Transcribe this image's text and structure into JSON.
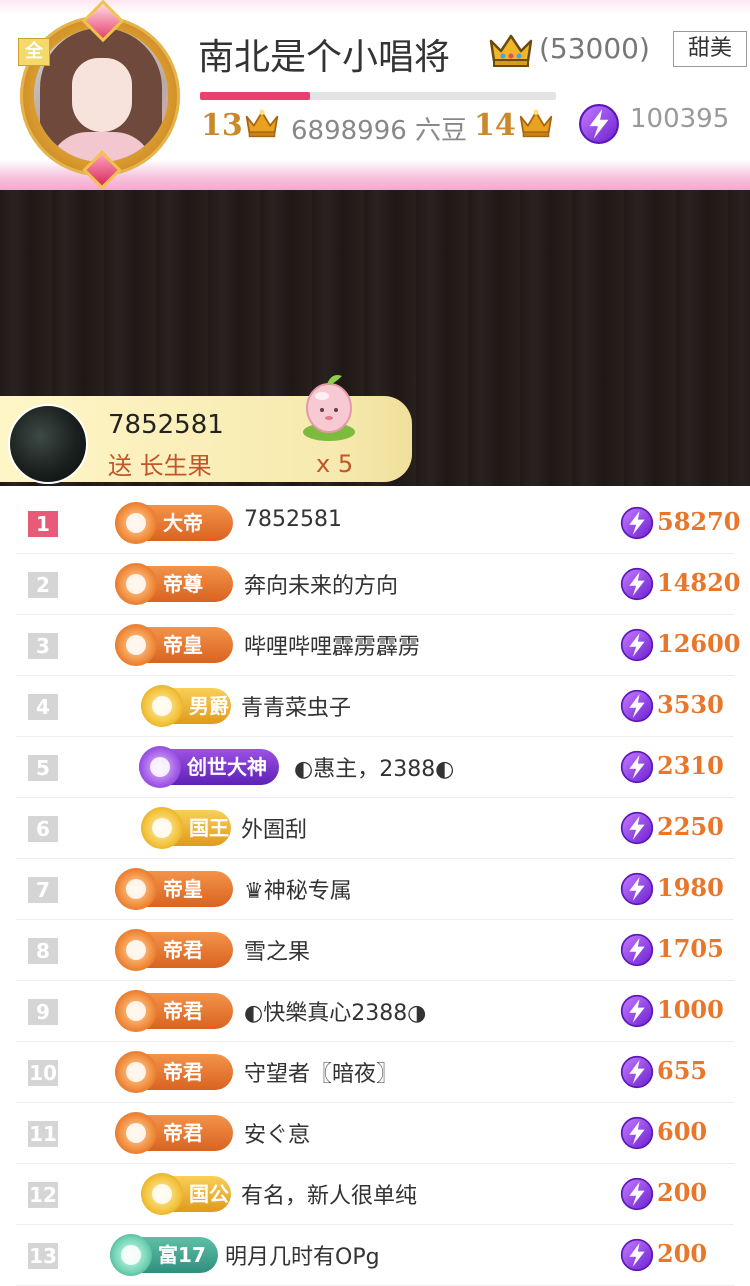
{
  "header": {
    "avatar_tag": "全",
    "streamer_name": "南北是个小唱将",
    "follower_count": "(53000)",
    "style_badge": "甜美",
    "level_progress": 0.31,
    "current_level": "13",
    "beans": "6898996 六豆",
    "next_level": "14",
    "points": "100395"
  },
  "gift_banner": {
    "sender_id": "7852581",
    "gift_text": "送 长生果",
    "count": "x 5"
  },
  "ranking": [
    {
      "rank": "1",
      "badge": "大帝",
      "badge_style": "orange",
      "name": "7852581",
      "points": "58270"
    },
    {
      "rank": "2",
      "badge": "帝尊",
      "badge_style": "orange",
      "name": "奔向未来的方向",
      "points": "14820"
    },
    {
      "rank": "3",
      "badge": "帝皇",
      "badge_style": "orange",
      "name": "哔哩哔哩霹雳霹雳",
      "points": "12600"
    },
    {
      "rank": "4",
      "badge": "男爵",
      "badge_style": "gold",
      "name": "青青菜虫子",
      "points": "3530"
    },
    {
      "rank": "5",
      "badge": "创世大神",
      "badge_style": "purple",
      "name": "◐惠主，2388◐",
      "points": "2310"
    },
    {
      "rank": "6",
      "badge": "国王",
      "badge_style": "gold",
      "name": "外圄刮",
      "points": "2250"
    },
    {
      "rank": "7",
      "badge": "帝皇",
      "badge_style": "orange",
      "name": "♛神秘专属",
      "points": "1980"
    },
    {
      "rank": "8",
      "badge": "帝君",
      "badge_style": "orange",
      "name": "雪之果",
      "points": "1705"
    },
    {
      "rank": "9",
      "badge": "帝君",
      "badge_style": "orange",
      "name": "◐快樂真心2388◑",
      "points": "1000"
    },
    {
      "rank": "10",
      "badge": "帝君",
      "badge_style": "orange",
      "name": "守望者〖暗夜〗",
      "points": "655"
    },
    {
      "rank": "11",
      "badge": "帝君",
      "badge_style": "orange",
      "name": "安ぐ恴",
      "points": "600"
    },
    {
      "rank": "12",
      "badge": "国公",
      "badge_style": "gold",
      "name": "有名，新人很单纯",
      "points": "200"
    },
    {
      "rank": "13",
      "badge": "富17",
      "badge_style": "teal",
      "name": "明月几时有OPg",
      "points": "200"
    }
  ],
  "colors": {
    "rank_first": "#e85a78",
    "rank_default": "#d5d5d5",
    "points": "#e8772c",
    "level_bar": "#e9416e",
    "coin": "#8a3fe0"
  },
  "icons": {
    "crown": "crown-icon",
    "coin": "lightning-coin-icon",
    "gift": "peach-gift-icon"
  }
}
